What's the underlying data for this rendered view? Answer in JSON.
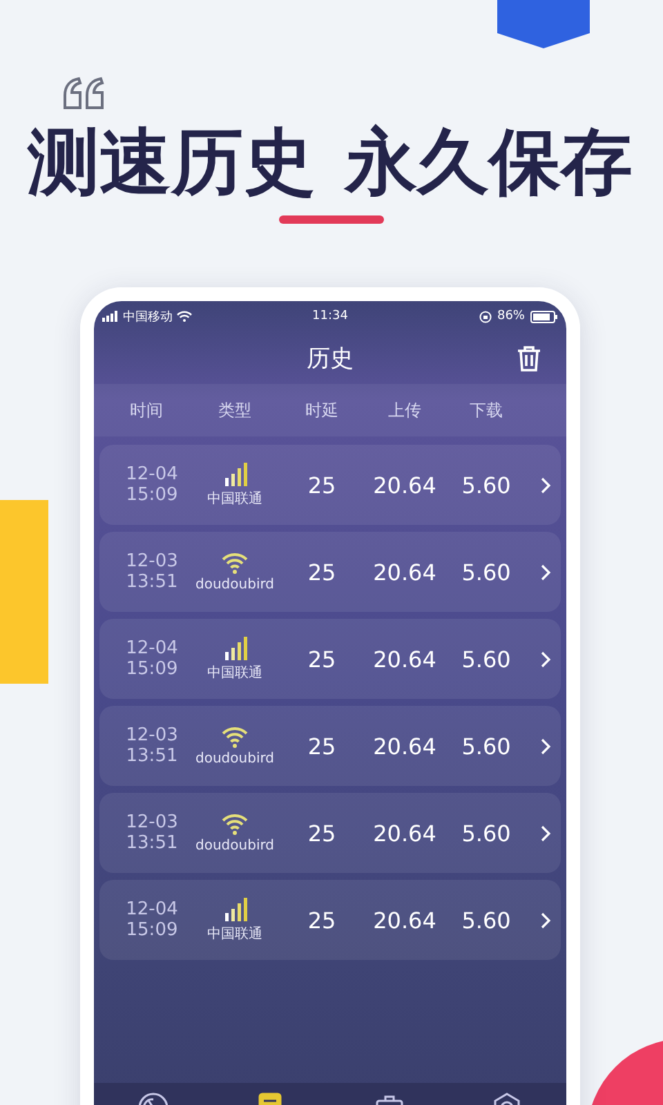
{
  "headline": {
    "part_1": "测速历史",
    "part_2": "永久保存"
  },
  "status_bar": {
    "carrier": "中国移动",
    "time": "11:34",
    "battery": "86%"
  },
  "title": "历史",
  "columns": [
    "时间",
    "类型",
    "时延",
    "上传",
    "下载"
  ],
  "rows": [
    {
      "date": "12-04",
      "time": "15:09",
      "kind": "cellular",
      "network": "中国联通",
      "latency": "25",
      "upload": "20.64",
      "download": "5.60"
    },
    {
      "date": "12-03",
      "time": "13:51",
      "kind": "wifi",
      "network": "doudoubird",
      "latency": "25",
      "upload": "20.64",
      "download": "5.60"
    },
    {
      "date": "12-04",
      "time": "15:09",
      "kind": "cellular",
      "network": "中国联通",
      "latency": "25",
      "upload": "20.64",
      "download": "5.60"
    },
    {
      "date": "12-03",
      "time": "13:51",
      "kind": "wifi",
      "network": "doudoubird",
      "latency": "25",
      "upload": "20.64",
      "download": "5.60"
    },
    {
      "date": "12-03",
      "time": "13:51",
      "kind": "wifi",
      "network": "doudoubird",
      "latency": "25",
      "upload": "20.64",
      "download": "5.60"
    },
    {
      "date": "12-04",
      "time": "15:09",
      "kind": "cellular",
      "network": "中国联通",
      "latency": "25",
      "upload": "20.64",
      "download": "5.60"
    }
  ],
  "tabs": [
    {
      "selected": false
    },
    {
      "selected": true
    },
    {
      "selected": false
    },
    {
      "selected": false
    }
  ]
}
